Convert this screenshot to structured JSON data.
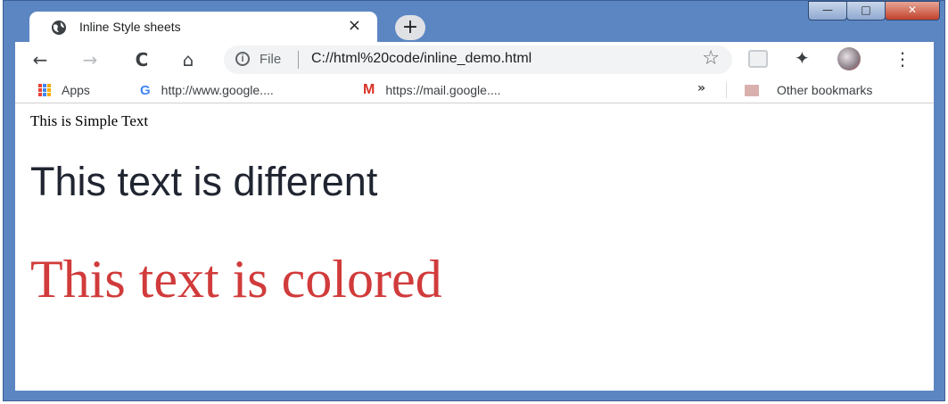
{
  "tab": {
    "title": "Inline Style sheets",
    "close_icon": "×"
  },
  "new_tab": {
    "label": "+"
  },
  "window_controls": {
    "minimize": "—",
    "maximize": "□",
    "close": "✕"
  },
  "toolbar": {
    "back": "←",
    "forward": "→",
    "reload": "C",
    "home": "⌂",
    "info": "i",
    "scheme_label": "File",
    "url": "C://html%20code/inline_demo.html",
    "star": "☆",
    "puzzle": "✦",
    "menu": "⋮"
  },
  "bookmarks": {
    "apps": "Apps",
    "items": [
      {
        "icon": "G",
        "label": "http://www.google...."
      },
      {
        "icon": "M",
        "label": "https://mail.google...."
      }
    ],
    "overflow": "»",
    "other": "Other bookmarks"
  },
  "page": {
    "simple_text": "This is Simple Text",
    "different_text": "This text is different",
    "colored_text": "This text is colored",
    "colors": {
      "colored": "#d13b3b",
      "different": "#202531"
    }
  }
}
